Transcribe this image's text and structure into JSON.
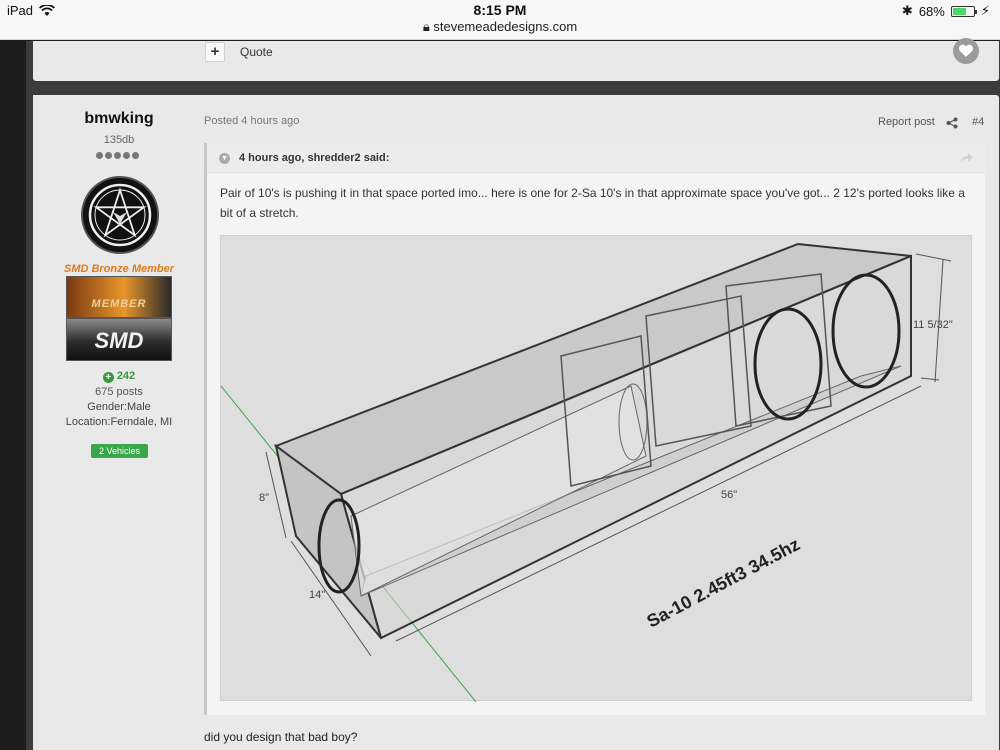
{
  "status_bar": {
    "device": "iPad",
    "time": "8:15 PM",
    "url": "stevemeadedesigns.com",
    "battery": "68%",
    "battery_level": 0.68
  },
  "previous_post": {
    "quote_label": "Quote"
  },
  "post": {
    "author": {
      "name": "bmwking",
      "rank": "135db",
      "title": "SMD Bronze Member",
      "badge_banner_text": "MEMBER",
      "badge_smd_text": "SMD",
      "reputation": "242",
      "posts": "675 posts",
      "gender": "Gender:Male",
      "location": "Location:Ferndale, MI",
      "vehicles": "2 Vehicles"
    },
    "posted": "Posted 4 hours ago",
    "report": "Report post",
    "number": "#4",
    "quote": {
      "citation": "4 hours ago, shredder2 said:",
      "text": "Pair of 10's is pushing it in that space ported imo... here is one for 2-Sa 10's in that approximate space you've got... 2 12's ported looks like a bit of a stretch.",
      "figure": {
        "dim_height": "11 5/32\"",
        "dim_length": "56\"",
        "dim_front": "8\"",
        "dim_depth": "14\"",
        "caption": "Sa-10 2.45ft3 34.5hz"
      }
    },
    "reply": "did you design that bad boy?"
  }
}
